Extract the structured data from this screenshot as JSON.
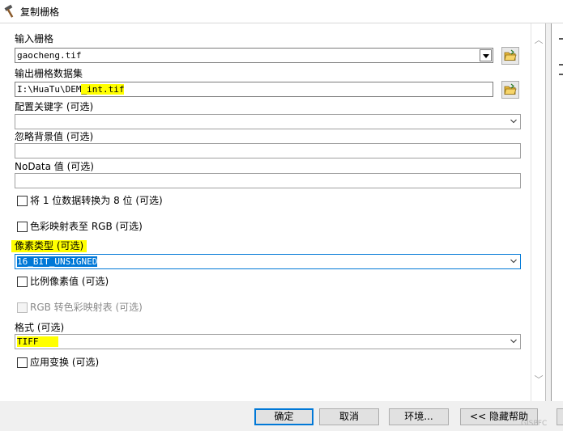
{
  "window": {
    "title": "复制栅格",
    "icon": "hammer-icon"
  },
  "fields": {
    "input_raster": {
      "label": "输入栅格",
      "value": "gaocheng.tif"
    },
    "output_raster": {
      "label": "输出栅格数据集",
      "value_prefix": "I:\\HuaTu\\DEM",
      "value_suffix": "_int.tif"
    },
    "config_keyword": {
      "label": "配置关键字 (可选)",
      "value": ""
    },
    "ignore_background": {
      "label": "忽略背景值 (可选)",
      "value": ""
    },
    "nodata": {
      "label": "NoData 值 (可选)",
      "value": ""
    },
    "pixel_type": {
      "label": "像素类型 (可选)",
      "value": "16_BIT_UNSIGNED"
    },
    "format": {
      "label": "格式 (可选)",
      "value": "TIFF"
    }
  },
  "checkboxes": {
    "convert_1bit": {
      "label": "将 1 位数据转换为 8 位 (可选)",
      "checked": false
    },
    "colormap_rgb": {
      "label": "色彩映射表至 RGB (可选)",
      "checked": false
    },
    "scale_pixel": {
      "label": "比例像素值 (可选)",
      "checked": false
    },
    "rgb_colormap": {
      "label": "RGB 转色彩映射表 (可选)",
      "checked": false,
      "enabled": false
    },
    "transform": {
      "label": "应用变换 (可选)",
      "checked": false
    }
  },
  "buttons": {
    "ok": "确定",
    "cancel": "取消",
    "environments": "环境...",
    "hide_help": "<< 隐藏帮助"
  },
  "watermark": "GISPFC",
  "colors": {
    "highlight": "#ffff00",
    "selection": "#0078d7",
    "folder": "#e8b83a"
  }
}
